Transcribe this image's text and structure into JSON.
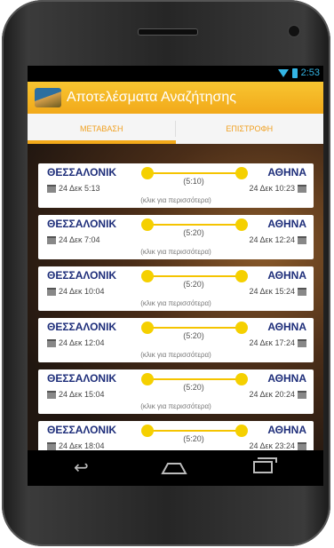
{
  "status": {
    "time": "2:53"
  },
  "app": {
    "title": "Αποτελέσματα Αναζήτησης"
  },
  "tabs": [
    {
      "label": "ΜΕΤΑΒΑΣΗ",
      "active": true
    },
    {
      "label": "ΕΠΙΣΤΡΟΦΗ",
      "active": false
    }
  ],
  "results": [
    {
      "from": "ΘΕΣΣΑΛΟΝΙΚ",
      "to": "ΑΘΗΝΑ",
      "duration": "(5:10)",
      "departure": "24 Δεκ 5:13",
      "arrival": "24 Δεκ 10:23",
      "more": "(κλικ για περισσότερα)"
    },
    {
      "from": "ΘΕΣΣΑΛΟΝΙΚ",
      "to": "ΑΘΗΝΑ",
      "duration": "(5:20)",
      "departure": "24 Δεκ 7:04",
      "arrival": "24 Δεκ 12:24",
      "more": "(κλικ για περισσότερα)"
    },
    {
      "from": "ΘΕΣΣΑΛΟΝΙΚ",
      "to": "ΑΘΗΝΑ",
      "duration": "(5:20)",
      "departure": "24 Δεκ 10:04",
      "arrival": "24 Δεκ 15:24",
      "more": "(κλικ για περισσότερα)"
    },
    {
      "from": "ΘΕΣΣΑΛΟΝΙΚ",
      "to": "ΑΘΗΝΑ",
      "duration": "(5:20)",
      "departure": "24 Δεκ 12:04",
      "arrival": "24 Δεκ 17:24",
      "more": "(κλικ για περισσότερα)"
    },
    {
      "from": "ΘΕΣΣΑΛΟΝΙΚ",
      "to": "ΑΘΗΝΑ",
      "duration": "(5:20)",
      "departure": "24 Δεκ 15:04",
      "arrival": "24 Δεκ 20:24",
      "more": "(κλικ για περισσότερα)"
    },
    {
      "from": "ΘΕΣΣΑΛΟΝΙΚ",
      "to": "ΑΘΗΝΑ",
      "duration": "(5:20)",
      "departure": "24 Δεκ 18:04",
      "arrival": "24 Δεκ 23:24",
      "more": ""
    }
  ],
  "navbar": {
    "back": "back-icon",
    "home": "home-icon",
    "recent": "recent-apps-icon"
  },
  "colors": {
    "accent": "#f2a91a",
    "station_text": "#1e2e7a",
    "route_line": "#f5c400",
    "status_icons": "#33b5e5"
  }
}
